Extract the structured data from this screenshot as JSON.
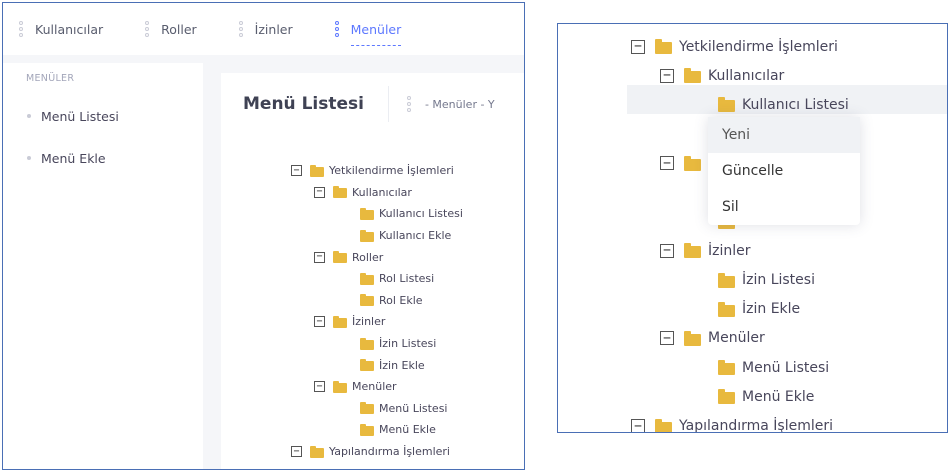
{
  "nav": {
    "tabs": [
      {
        "label": "Kullanıcılar"
      },
      {
        "label": "Roller"
      },
      {
        "label": "İzinler"
      },
      {
        "label": "Menüler"
      }
    ]
  },
  "sidebar": {
    "title": "MENÜLER",
    "items": [
      {
        "label": "Menü Listesi"
      },
      {
        "label": "Menü Ekle"
      }
    ]
  },
  "content": {
    "title": "Menü Listesi",
    "breadcrumb": "- Menüler - Y"
  },
  "tree": [
    {
      "label": "Yetkilendirme İşlemleri",
      "level": 0,
      "expandable": true
    },
    {
      "label": "Kullanıcılar",
      "level": 1,
      "expandable": true
    },
    {
      "label": "Kullanıcı Listesi",
      "level": 2,
      "expandable": false
    },
    {
      "label": "Kullanıcı Ekle",
      "level": 2,
      "expandable": false
    },
    {
      "label": "Roller",
      "level": 1,
      "expandable": true
    },
    {
      "label": "Rol Listesi",
      "level": 2,
      "expandable": false
    },
    {
      "label": "Rol Ekle",
      "level": 2,
      "expandable": false
    },
    {
      "label": "İzinler",
      "level": 1,
      "expandable": true
    },
    {
      "label": "İzin Listesi",
      "level": 2,
      "expandable": false
    },
    {
      "label": "İzin Ekle",
      "level": 2,
      "expandable": false
    },
    {
      "label": "Menüler",
      "level": 1,
      "expandable": true
    },
    {
      "label": "Menü Listesi",
      "level": 2,
      "expandable": false
    },
    {
      "label": "Menü Ekle",
      "level": 2,
      "expandable": false
    },
    {
      "label": "Yapılandırma İşlemleri",
      "level": 0,
      "expandable": true
    }
  ],
  "zoomed_tree": [
    {
      "label": "Yetkilendirme İşlemleri",
      "level": 0,
      "expandable": true
    },
    {
      "label": "Kullanıcılar",
      "level": 1,
      "expandable": true
    },
    {
      "label": "Kullanıcı Listesi",
      "level": 2,
      "expandable": false
    },
    {
      "label": "",
      "level": 2,
      "expandable": false
    },
    {
      "label": "",
      "level": 1,
      "expandable": true
    },
    {
      "label": "",
      "level": 2,
      "expandable": false
    },
    {
      "label": "",
      "level": 2,
      "expandable": false
    },
    {
      "label": "İzinler",
      "level": 1,
      "expandable": true
    },
    {
      "label": "İzin Listesi",
      "level": 2,
      "expandable": false
    },
    {
      "label": "İzin Ekle",
      "level": 2,
      "expandable": false
    },
    {
      "label": "Menüler",
      "level": 1,
      "expandable": true
    },
    {
      "label": "Menü Listesi",
      "level": 2,
      "expandable": false
    },
    {
      "label": "Menü Ekle",
      "level": 2,
      "expandable": false
    },
    {
      "label": "Yapılandırma İşlemleri",
      "level": 0,
      "expandable": true
    }
  ],
  "context_menu": {
    "items": [
      {
        "label": "Yeni"
      },
      {
        "label": "Güncelle"
      },
      {
        "label": "Sil"
      }
    ]
  },
  "icons": {
    "toggle": "collapse-box-icon",
    "folder": "folder-icon",
    "nav_dots": "dots-icon"
  },
  "colors": {
    "accent": "#5d78ff",
    "folder": "#e8b93e",
    "panel_border": "#4a6fb5"
  }
}
